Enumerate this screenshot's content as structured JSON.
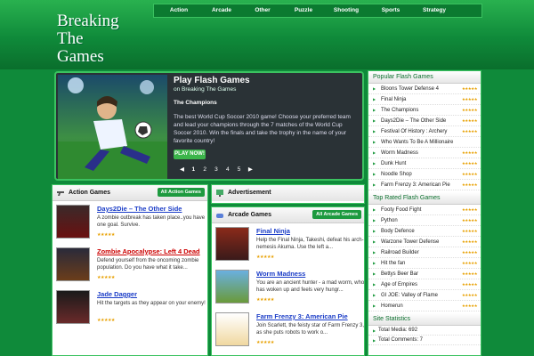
{
  "logo": {
    "line1": "Breaking",
    "line2": "The",
    "line3": "Games"
  },
  "nav": [
    "Action",
    "Arcade",
    "Other",
    "Puzzle",
    "Shooting",
    "Sports",
    "Strategy"
  ],
  "feature": {
    "title": "Play Flash Games",
    "subtitle": "on Breaking The Games",
    "heading": "The Champions",
    "description": "The best World Cup Soccer 2010 game! Choose your preferred team and lead your champions through the 7 matches of the World Cup Soccer 2010. Win the finals and take the trophy in the name of your favorite country!",
    "play_label": "PLAY NOW!",
    "pages": [
      "◀",
      "1",
      "2",
      "3",
      "4",
      "5",
      "▶"
    ],
    "active_page": "1"
  },
  "action_games": {
    "title": "Action Games",
    "more": "All Action Games",
    "items": [
      {
        "title": "Days2Die – The Other Side",
        "desc": "A zombie outbreak has taken place..you have one goal. Survive.",
        "rating": "★★★★★"
      },
      {
        "title": "Zombie Apocalypse: Left 4 Dead",
        "desc": "Defend yourself from the oncoming zombie population. Do you have what it take...",
        "rating": "★★★★★"
      },
      {
        "title": "Jade Dagger",
        "desc": "Hit the targets as they appear on your enemy!",
        "rating": "★★★★★"
      }
    ]
  },
  "advertisement": {
    "title": "Advertisement"
  },
  "arcade_games": {
    "title": "Arcade Games",
    "more": "All Arcade Games",
    "items": [
      {
        "title": "Final Ninja",
        "desc": "Help the Final Ninja, Takeshi, defeat his arch-nemesis Akuma. Use the left a...",
        "rating": "★★★★★"
      },
      {
        "title": "Worm Madness",
        "desc": "You are an ancient hunter - a mad worm, who has woken up and feels very hungr...",
        "rating": "★★★★★"
      },
      {
        "title": "Farm Frenzy 3: American Pie",
        "desc": "Join Scarlett, the feisty star of Farm Frenzy 3, as she puts robots to work o...",
        "rating": "★★★★★"
      }
    ]
  },
  "popular": {
    "title": "Popular Flash Games",
    "items": [
      "Bloons Tower Defense 4",
      "Final Ninja",
      "The Champions",
      "Days2Die – The Other Side",
      "Festival Of History : Archery",
      "Who Wants To Be A Millionaire",
      "Worm Madness",
      "Dunk Hunt",
      "Noodle Shop",
      "Farm Frenzy 3: American Pie"
    ],
    "rating": "★★★★★"
  },
  "top_rated": {
    "title": "Top Rated Flash Games",
    "items": [
      "Footy Food Fight",
      "Python",
      "Body Defence",
      "Warzone Tower Defense",
      "Railroad Builder",
      "Hit the fan",
      "Bettys Beer Bar",
      "Age of Empires",
      "GI JOE: Valley of Flame",
      "Homerun"
    ],
    "rating": "★★★★★"
  },
  "stats": {
    "title": "Site Statistics",
    "items": [
      "Total Media: 692",
      "Total Comments: 7"
    ]
  },
  "colors": {
    "brand_green": "#0f8a3a",
    "accent": "#3bc260",
    "title_red": "#cc0000",
    "star": "#e8a000"
  }
}
